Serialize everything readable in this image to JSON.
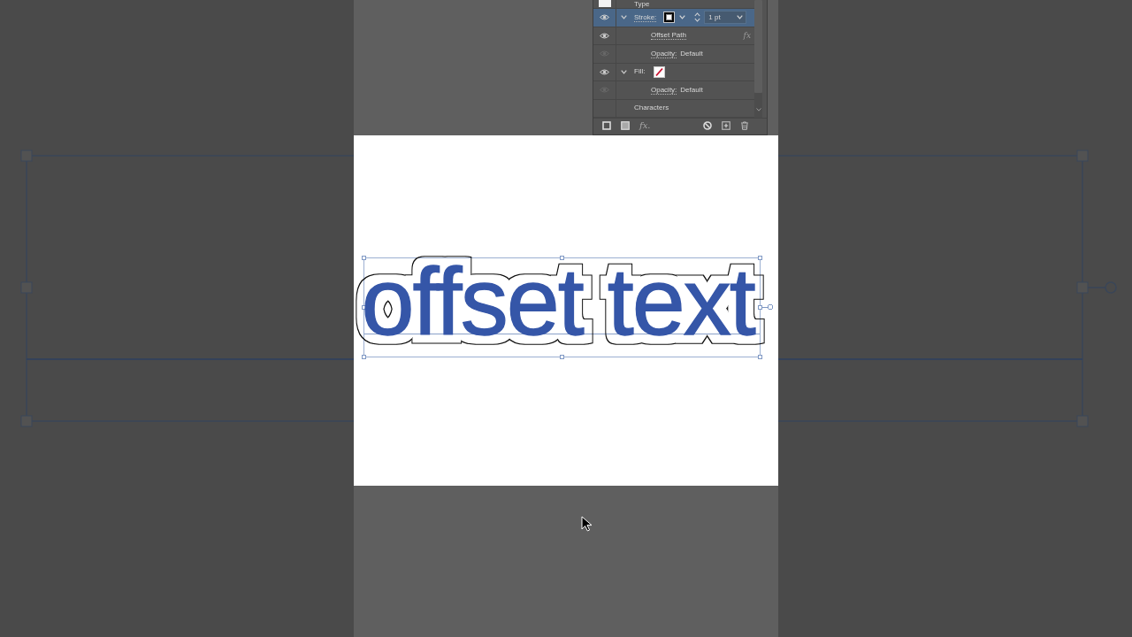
{
  "appearance_panel": {
    "items": [
      {
        "kind": "header",
        "label": "Type",
        "selected": false
      },
      {
        "kind": "stroke",
        "label": "Stroke:",
        "visible": true,
        "expanded": true,
        "selected": true,
        "swatch": {
          "kind": "solid",
          "color": "#000000"
        },
        "weight": "1 pt",
        "children": [
          {
            "kind": "effect",
            "label": "Offset Path",
            "fx": "fx",
            "visible": true,
            "selected": false
          },
          {
            "kind": "opacity",
            "label": "Opacity:",
            "value": "Default",
            "visible": false,
            "selected": false
          }
        ]
      },
      {
        "kind": "fill",
        "label": "Fill:",
        "visible": true,
        "expanded": true,
        "selected": false,
        "swatch": {
          "kind": "none"
        },
        "children": [
          {
            "kind": "opacity",
            "label": "Opacity:",
            "value": "Default",
            "visible": false,
            "selected": false
          }
        ]
      },
      {
        "kind": "group",
        "label": "Characters",
        "selected": false
      }
    ],
    "footer": {
      "effects_button": "fx."
    }
  },
  "artboard": {
    "text": "offset text",
    "selected": true
  }
}
